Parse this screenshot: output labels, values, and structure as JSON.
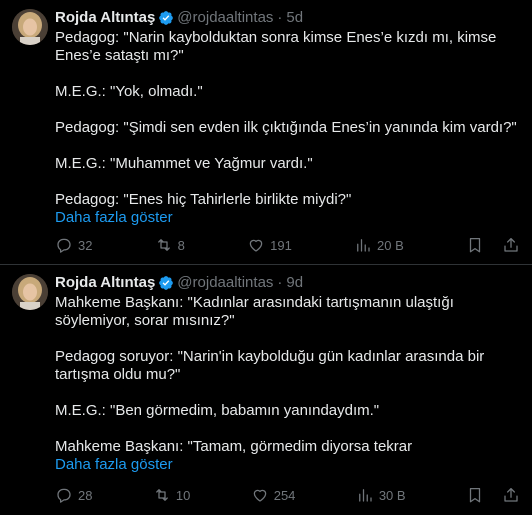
{
  "tweets": [
    {
      "author": {
        "name": "Rojda Altıntaş",
        "handle": "@rojdaaltintas",
        "time": "5d"
      },
      "paragraphs": [
        "Pedagog: \"Narin kaybolduktan sonra kimse Enes’e kızdı mı, kimse Enes’e sataştı mı?\"",
        "M.E.G.: \"Yok, olmadı.\"",
        "Pedagog: \"Şimdi sen evden ilk çıktığında Enes’in yanında kim vardı?\"",
        "M.E.G.: \"Muhammet ve Yağmur vardı.\"",
        "Pedagog: \"Enes hiç Tahirlerle birlikte miydi?\""
      ],
      "show_more": "Daha fazla göster",
      "stats": {
        "replies": "32",
        "reposts": "8",
        "likes": "191",
        "views": "20 B"
      }
    },
    {
      "author": {
        "name": "Rojda Altıntaş",
        "handle": "@rojdaaltintas",
        "time": "9d"
      },
      "paragraphs": [
        "Mahkeme Başkanı: \"Kadınlar arasındaki tartışmanın ulaştığı söylemiyor, sorar mısınız?\"",
        "Pedagog soruyor: \"Narin'in kaybolduğu gün kadınlar arasında bir tartışma oldu mu?\"",
        "M.E.G.: \"Ben görmedim, babamın yanındaydım.\"",
        "Mahkeme Başkanı: \"Tamam, görmedim diyorsa tekrar"
      ],
      "show_more": "Daha fazla göster",
      "stats": {
        "replies": "28",
        "reposts": "10",
        "likes": "254",
        "views": "30 B"
      }
    }
  ],
  "colors": {
    "background": "#000000",
    "text": "#e7e9ea",
    "muted": "#71767b",
    "link": "#1d9bf0",
    "verified": "#1d9bf0",
    "divider": "#2f3336"
  }
}
